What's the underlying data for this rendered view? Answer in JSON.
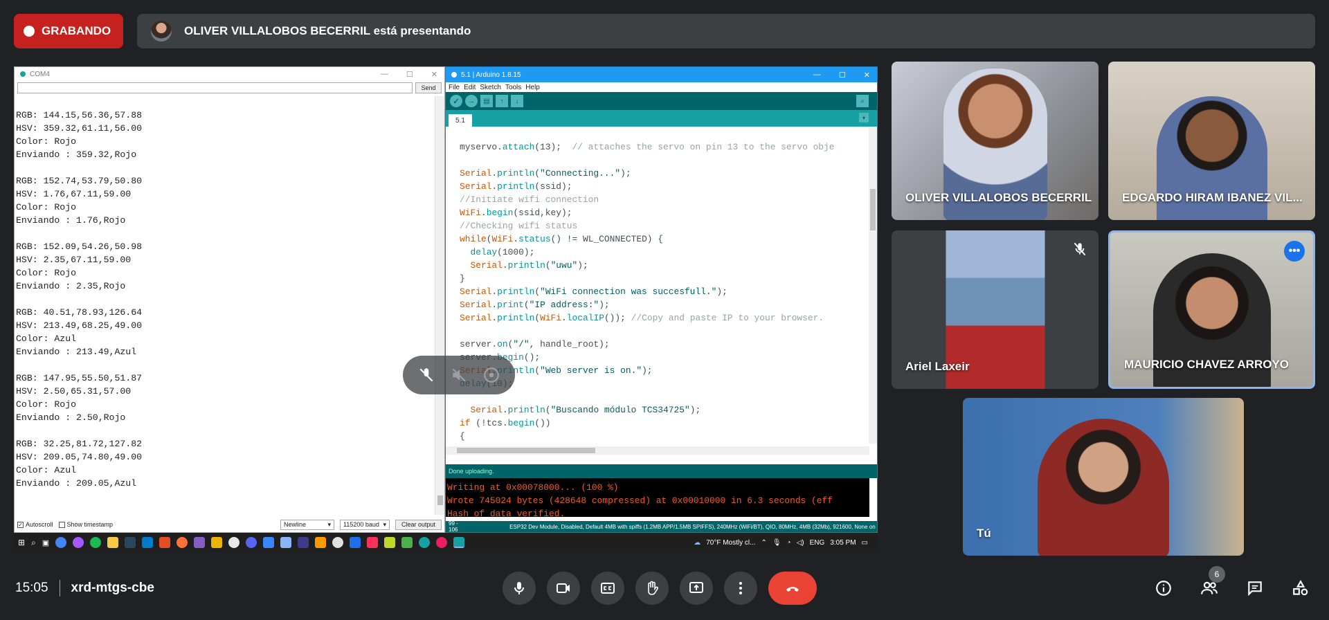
{
  "recording": {
    "label": "GRABANDO"
  },
  "presenting": {
    "text": "OLIVER VILLALOBOS BECERRIL está presentando"
  },
  "shared_screen": {
    "serial_monitor": {
      "title": "COM4",
      "send_label": "Send",
      "output_lines": [
        "RGB: 144.15,56.36,57.88",
        "HSV: 359.32,61.11,56.00",
        "Color: Rojo",
        "Enviando : 359.32,Rojo",
        "",
        "RGB: 152.74,53.79,50.80",
        "HSV: 1.76,67.11,59.00",
        "Color: Rojo",
        "Enviando : 1.76,Rojo",
        "",
        "RGB: 152.09,54.26,50.98",
        "HSV: 2.35,67.11,59.00",
        "Color: Rojo",
        "Enviando : 2.35,Rojo",
        "",
        "RGB: 40.51,78.93,126.64",
        "HSV: 213.49,68.25,49.00",
        "Color: Azul",
        "Enviando : 213.49,Azul",
        "",
        "RGB: 147.95,55.50,51.87",
        "HSV: 2.50,65.31,57.00",
        "Color: Rojo",
        "Enviando : 2.50,Rojo",
        "",
        "RGB: 32.25,81.72,127.82",
        "HSV: 209.05,74.80,49.00",
        "Color: Azul",
        "Enviando : 209.05,Azul"
      ],
      "autoscroll_label": "Autoscroll",
      "timestamp_label": "Show timestamp",
      "line_ending": "Newline",
      "baud": "115200 baud",
      "clear_label": "Clear output"
    },
    "arduino": {
      "title": "5.1 | Arduino 1.8.15",
      "menu": [
        "File",
        "Edit",
        "Sketch",
        "Tools",
        "Help"
      ],
      "tab": "5.1",
      "status": "Done uploading.",
      "console_lines": [
        "Writing at 0x00078000... (100 %)",
        "Wrote 745024 bytes (428648 compressed) at 0x00010000 in 6.3 seconds (eff",
        "Hash of data verified."
      ],
      "footer_left": "99 - 106",
      "footer_right": "ESP32 Dev Module, Disabled, Default 4MB with spiffs (1.2MB APP/1.5MB SPIFFS), 240MHz (WiFi/BT), QIO, 80MHz, 4MB (32Mb), 921600, None on COM4"
    },
    "taskbar": {
      "weather": "70°F  Mostly cl...",
      "lang": "ENG",
      "time": "3:05 PM"
    }
  },
  "participants": [
    {
      "name": "OLIVER VILLALOBOS BECERRIL"
    },
    {
      "name": "EDGARDO HIRAM IBANEZ VIL..."
    },
    {
      "name": "Ariel Laxeir"
    },
    {
      "name": "MAURICIO CHAVEZ ARROYO"
    },
    {
      "name": "Tú"
    }
  ],
  "footer": {
    "time": "15:05",
    "meeting_code": "xrd-mtgs-cbe",
    "people_count": "6"
  },
  "colors": {
    "accent": "#1a73e8",
    "record": "#c5221f",
    "end_call": "#ea4335",
    "active_border": "#8ab4f8"
  }
}
